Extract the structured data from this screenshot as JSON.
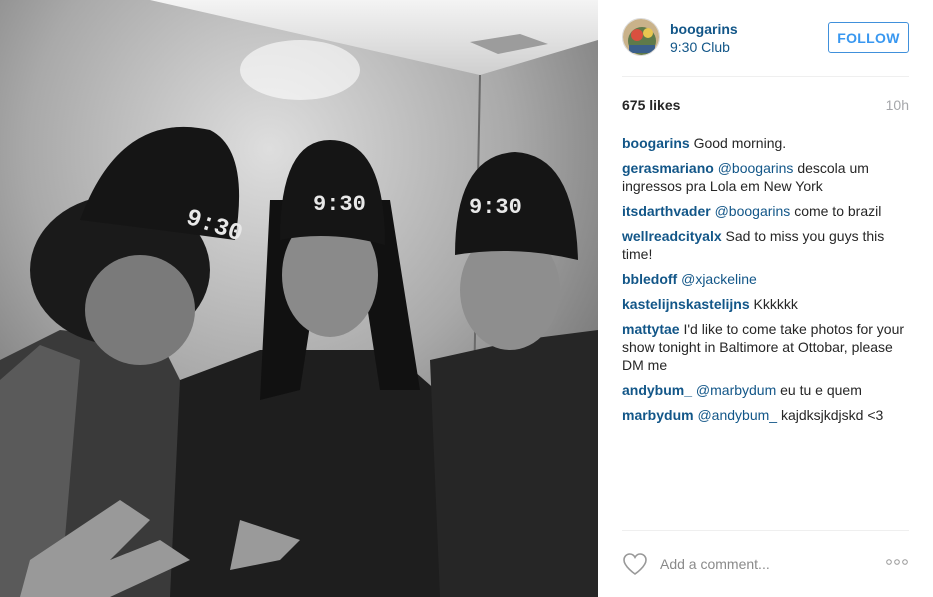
{
  "post": {
    "photo_alt": "Three men in black 9:30 beanies",
    "beanie_text": "9:30"
  },
  "header": {
    "username": "boogarins",
    "location": "9:30 Club",
    "follow_label": "FOLLOW"
  },
  "stats": {
    "likes": "675 likes",
    "time": "10h"
  },
  "comments": [
    {
      "user": "boogarins",
      "mention": "",
      "text": "Good morning."
    },
    {
      "user": "gerasmariano",
      "mention": "@boogarins",
      "text": "descola um ingressos pra Lola em New York"
    },
    {
      "user": "itsdarthvader",
      "mention": "@boogarins",
      "text": "come to brazil"
    },
    {
      "user": "wellreadcityalx",
      "mention": "",
      "text": "Sad to miss you guys this time!"
    },
    {
      "user": "bbledoff",
      "mention": "@xjackeline",
      "text": ""
    },
    {
      "user": "kastelijnskastelijns",
      "mention": "",
      "text": "Kkkkkk"
    },
    {
      "user": "mattytae",
      "mention": "",
      "text": "I'd like to come take photos for your show tonight in Baltimore at Ottobar, please DM me"
    },
    {
      "user": "andybum_",
      "mention": "@marbydum",
      "text": "eu tu e quem"
    },
    {
      "user": "marbydum",
      "mention": "@andybum_",
      "text": "kajdksjkdjskd <3"
    }
  ],
  "actions": {
    "comment_placeholder": "Add a comment...",
    "heart_icon": "heart-outline-icon",
    "more_icon": "more-options-icon"
  },
  "colors": {
    "link": "#125688",
    "follow": "#3897f0",
    "muted": "#a5a7aa"
  }
}
